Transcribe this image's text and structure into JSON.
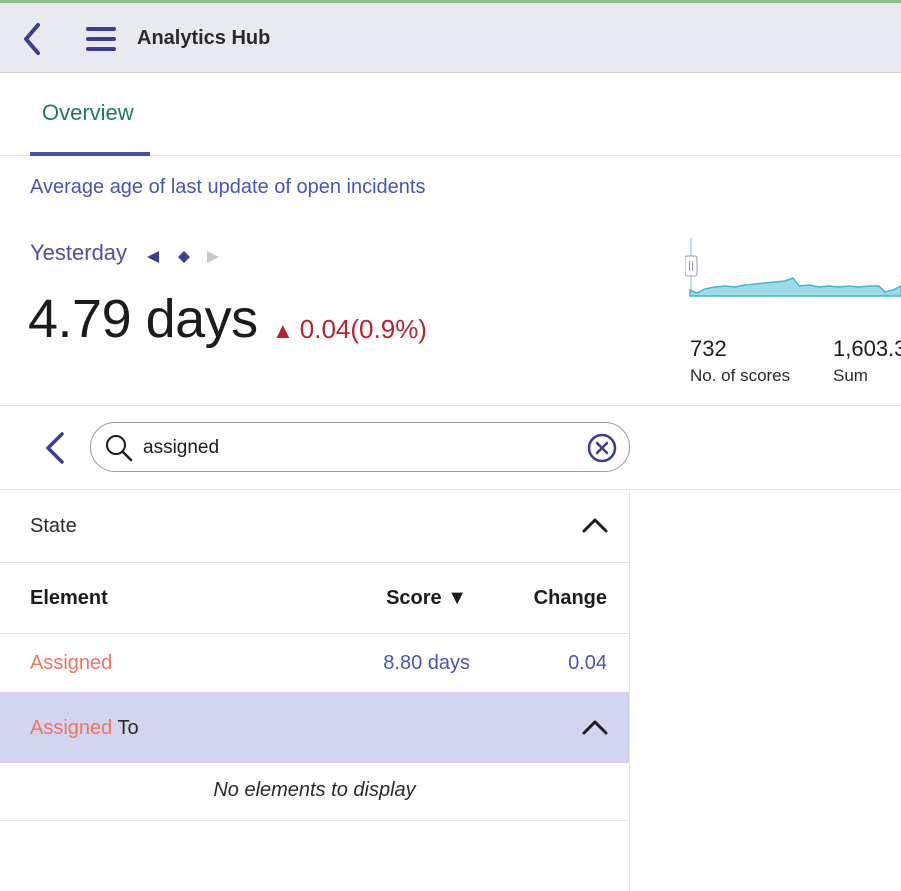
{
  "header": {
    "title": "Analytics Hub",
    "back_icon": "chevron-left-icon",
    "menu_icon": "hamburger-menu-icon"
  },
  "tabs": [
    {
      "label": "Overview",
      "active": true
    }
  ],
  "metric": {
    "title": "Average age of last update of open incidents",
    "period": "Yesterday",
    "value": "4.79 days",
    "delta_symbol": "▲",
    "delta": "0.04",
    "delta_pct": "(0.9%)",
    "delta_color": "#b8232f"
  },
  "stats": [
    {
      "value": "732",
      "label": "No. of scores"
    },
    {
      "value": "1,603.3",
      "label": "Sum"
    }
  ],
  "search": {
    "value": "assigned",
    "placeholder": ""
  },
  "breakdown": {
    "group1_label": "State",
    "columns": {
      "element": "Element",
      "score": "Score ▼",
      "change": "Change"
    },
    "rows": [
      {
        "element": "Assigned",
        "score": "8.80 days",
        "change": "0.04"
      }
    ],
    "group2_highlight": "Assigned",
    "group2_rest": " To",
    "empty_text": "No elements to display"
  },
  "colors": {
    "accent": "#4a4fa8",
    "link": "#4655b8",
    "tab_text": "#1e7a5f",
    "highlight_row": "#d3d4ef",
    "match": "#f07561",
    "sparkline": "#5bc8dc"
  }
}
